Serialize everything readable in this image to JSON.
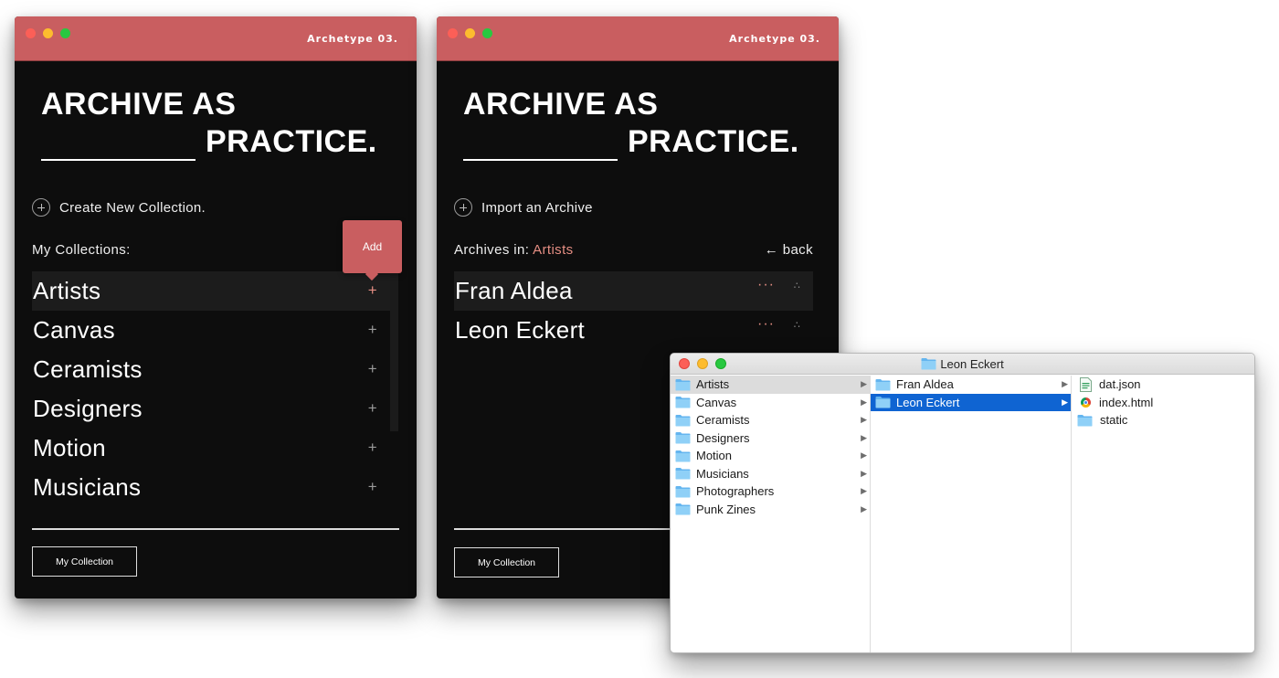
{
  "brand": "Archetype 03.",
  "headline": {
    "line1": "ARCHIVE AS",
    "line2": "PRACTICE."
  },
  "window_left": {
    "action": "Create New Collection.",
    "section_label": "My Collections:",
    "tooltip": "Add",
    "collections": [
      "Artists",
      "Canvas",
      "Ceramists",
      "Designers",
      "Motion",
      "Musicians"
    ],
    "selected_index": 0,
    "row_icon_text": "+",
    "footer_button": "My Collection"
  },
  "window_right": {
    "action": "Import an Archive",
    "section_label_prefix": "Archives in: ",
    "section_label_accent": "Artists",
    "back_label": "← back",
    "archives": [
      "Fran Aldea",
      "Leon Eckert"
    ],
    "dots_text": "···",
    "grip_text": "∴",
    "footer_button": "My Collection"
  },
  "finder": {
    "title": "Leon Eckert",
    "column1": [
      "Artists",
      "Canvas",
      "Ceramists",
      "Designers",
      "Motion",
      "Musicians",
      "Photographers",
      "Punk Zines"
    ],
    "column2": [
      "Fran Aldea",
      "Leon Eckert"
    ],
    "column3": [
      {
        "name": "dat.json",
        "icon": "json-file-icon"
      },
      {
        "name": "index.html",
        "icon": "chrome-html-icon"
      },
      {
        "name": "static",
        "icon": "folder-icon"
      }
    ],
    "chevron": "▶"
  },
  "colors": {
    "titlebar": "#c95e60",
    "accent": "#e58e83",
    "window_bg": "#0d0d0d",
    "finder_selection": "#0f64d2"
  }
}
